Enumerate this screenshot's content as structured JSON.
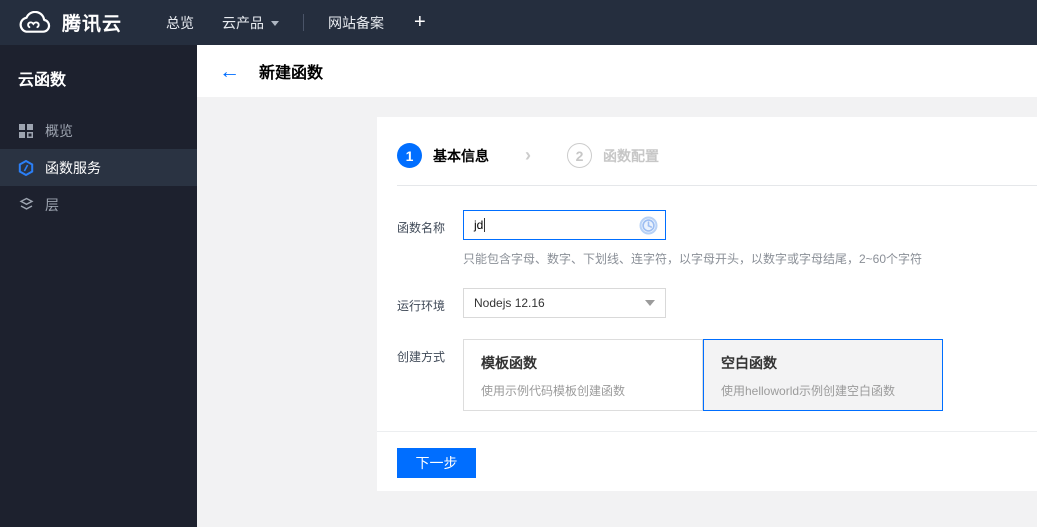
{
  "topbar": {
    "brand": "腾讯云",
    "menu": [
      {
        "label": "总览"
      },
      {
        "label": "云产品"
      },
      {
        "label": "网站备案"
      }
    ],
    "plus_label": "+"
  },
  "sidebar": {
    "title": "云函数",
    "items": [
      {
        "label": "概览",
        "selected": false
      },
      {
        "label": "函数服务",
        "selected": true
      },
      {
        "label": "层",
        "selected": false
      }
    ]
  },
  "header": {
    "back": "←",
    "title": "新建函数"
  },
  "steps": {
    "items": [
      {
        "number": "1",
        "label": "基本信息",
        "active": true
      },
      {
        "number": "2",
        "label": "函数配置",
        "active": false
      }
    ],
    "chevron": "›"
  },
  "form": {
    "name": {
      "label": "函数名称",
      "value": "jd",
      "help": "只能包含字母、数字、下划线、连字符，以字母开头，以数字或字母结尾，2~60个字符"
    },
    "runtime": {
      "label": "运行环境",
      "value": "Nodejs 12.16"
    },
    "method": {
      "label": "创建方式",
      "options": [
        {
          "title": "模板函数",
          "desc": "使用示例代码模板创建函数",
          "selected": false
        },
        {
          "title": "空白函数",
          "desc": "使用helloworld示例创建空白函数",
          "selected": true
        }
      ]
    },
    "next_label": "下一步"
  },
  "colors": {
    "accent": "#006eff",
    "topbar_bg": "#252e3e",
    "sidebar_bg": "#1d212e",
    "sidebar_selected_bg": "#2a3342",
    "content_bg": "#f2f2f3",
    "step_inactive": "#c7c7c7"
  }
}
